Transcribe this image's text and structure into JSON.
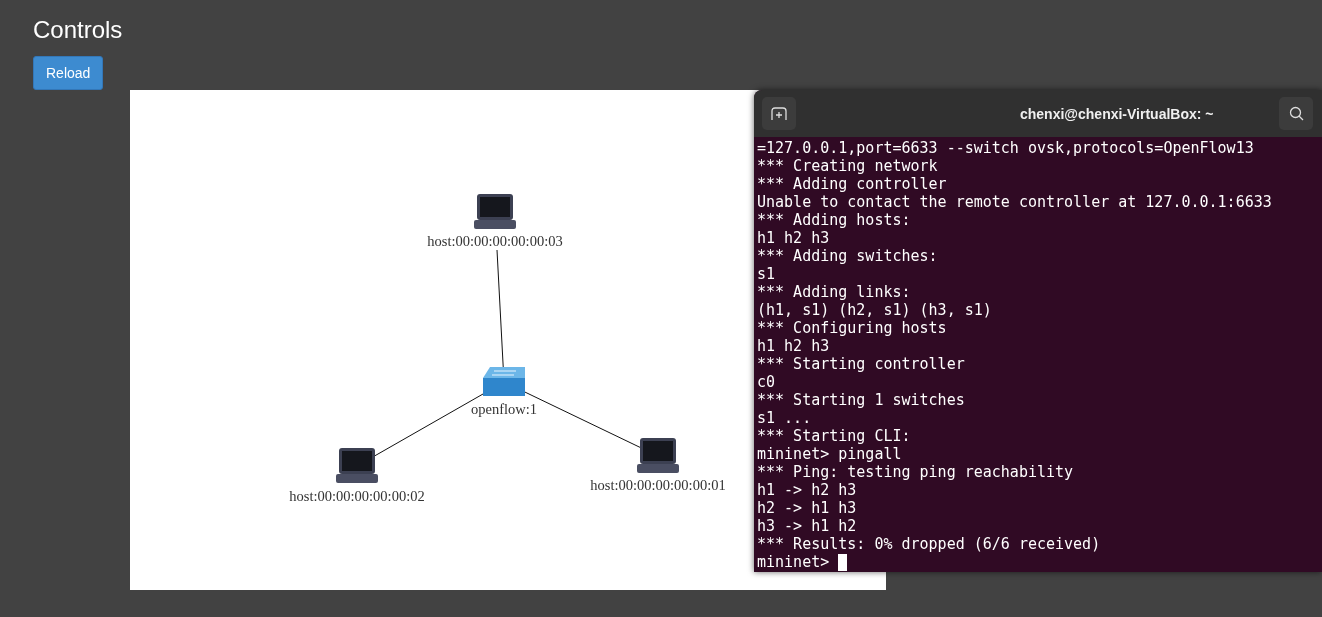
{
  "heading": "Controls",
  "reload_button": "Reload",
  "topology": {
    "nodes": [
      {
        "kind": "host",
        "label": "host:00:00:00:00:00:03"
      },
      {
        "kind": "switch",
        "label": "openflow:1"
      },
      {
        "kind": "host",
        "label": "host:00:00:00:00:00:02"
      },
      {
        "kind": "host",
        "label": "host:00:00:00:00:00:01"
      }
    ]
  },
  "terminal": {
    "title": "chenxi@chenxi-VirtualBox: ~",
    "lines": [
      "=127.0.0.1,port=6633 --switch ovsk,protocols=OpenFlow13",
      "*** Creating network",
      "*** Adding controller",
      "Unable to contact the remote controller at 127.0.0.1:6633",
      "*** Adding hosts:",
      "h1 h2 h3",
      "*** Adding switches:",
      "s1",
      "*** Adding links:",
      "(h1, s1) (h2, s1) (h3, s1)",
      "*** Configuring hosts",
      "h1 h2 h3",
      "*** Starting controller",
      "c0",
      "*** Starting 1 switches",
      "s1 ...",
      "*** Starting CLI:",
      "mininet> pingall",
      "*** Ping: testing ping reachability",
      "h1 -> h2 h3",
      "h2 -> h1 h3",
      "h3 -> h1 h2",
      "*** Results: 0% dropped (6/6 received)"
    ],
    "prompt": "mininet>"
  }
}
